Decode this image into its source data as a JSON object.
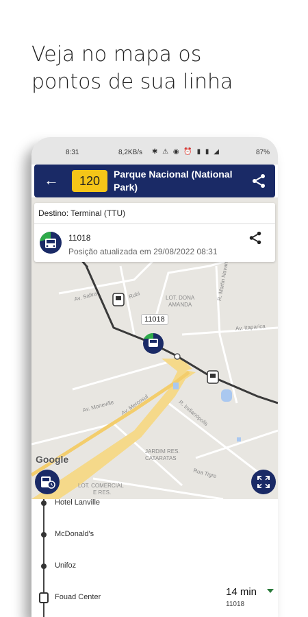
{
  "headline": {
    "line1": "Veja no mapa os",
    "line2": "pontos de sua linha"
  },
  "statusbar": {
    "time": "8:31",
    "speed": "8,2KB/s",
    "battery": "87%"
  },
  "appbar": {
    "line_number": "120",
    "title": "Parque Nacional (National Park)"
  },
  "info_card": {
    "destino": "Destino: Terminal (TTU)",
    "vehicle_id": "11018",
    "updated": "Posição atualizada em 29/08/2022 08:31"
  },
  "map": {
    "vehicle_tag": "11018",
    "google": "Google",
    "labels": {
      "av_safira": "Av. Safira",
      "rubi": "Rubi",
      "lot_dona_amanda_1": "LOT. DONA",
      "lot_dona_amanda_2": "AMANDA",
      "r_martin_navarro": "R. Martin Navarro",
      "av_itaparica": "Av. Itaparica",
      "av_mercosul": "Av. Mercosul",
      "av_moneville": "Av. Moneville",
      "r_indianopolis": "R. Indianópolis",
      "jardim_res_1": "JARDIM RES.",
      "jardim_res_2": "CATARATAS",
      "rua_tigre": "Rua Tigre",
      "lot_comercial_1": "LOT. COMERCIAL",
      "lot_comercial_2": "E RES."
    }
  },
  "stops": [
    {
      "label": "Hotel Lanville"
    },
    {
      "label": "McDonald's"
    },
    {
      "label": "Unifoz"
    },
    {
      "label": "Fouad Center"
    }
  ],
  "eta": {
    "time": "14 min",
    "vehicle": "11018"
  },
  "colors": {
    "navy": "#1a2a66",
    "badge_yellow": "#f5c518",
    "route_line": "#3a3a3a"
  }
}
